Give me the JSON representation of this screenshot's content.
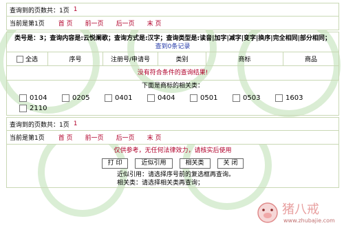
{
  "summary_top": {
    "label": "查询到的页数共：",
    "pages": "1页",
    "count": "1"
  },
  "nav_top": {
    "current": "当前是第1页",
    "first": "首 页",
    "prev": "前一页",
    "next": "后一页",
    "last": "末 页"
  },
  "query_info": "类号是：3；查询内容是:云悦阑歌；查询方式是:汉字；查询类型是:读音|加字|减字|变字|换序|完全相同|部分相同；",
  "record_count": "查到0条记录",
  "table_headers": {
    "select_all": "全选",
    "serial": "序号",
    "reg_no": "注册号/申请号",
    "category": "类别",
    "trademark": "商标",
    "goods": "商品"
  },
  "no_result": "没有符合条件的查询结果!",
  "related_title": "下面是商标的相关类：",
  "classes": [
    "0104",
    "0205",
    "0401",
    "0404",
    "0501",
    "0503",
    "1603",
    "2110"
  ],
  "summary_bottom": {
    "label": "查询到的页数共：",
    "pages": "1页",
    "count": "1"
  },
  "nav_bottom": {
    "current": "当前是第1页",
    "first": "首 页",
    "prev": "前一页",
    "next": "后一页",
    "last": "末 页"
  },
  "disclaimer": "仅供参考，无任何法律效力，请核实后使用",
  "buttons": {
    "print": "打 印",
    "similar": "近似引用",
    "related": "相关类",
    "close": "关 闭"
  },
  "notes": {
    "line1": "近似引用：请选择序号前的复选框再查询。",
    "line2": "相关类：请选择相关类再查询；"
  },
  "logo": {
    "text": "猪八戒",
    "url": "www.zhubajie.com"
  }
}
